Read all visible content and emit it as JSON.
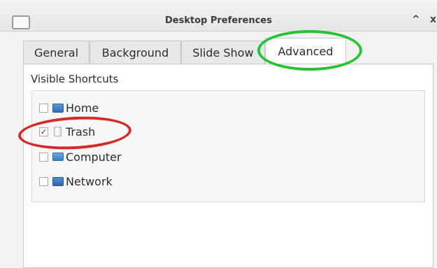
{
  "window": {
    "title": "Desktop Preferences",
    "maximize_glyph": "^",
    "close_glyph": "x"
  },
  "tabs": [
    {
      "label": "General",
      "active": false
    },
    {
      "label": "Background",
      "active": false
    },
    {
      "label": "Slide Show",
      "active": false
    },
    {
      "label": "Advanced",
      "active": true
    }
  ],
  "advanced": {
    "section_title": "Visible Shortcuts",
    "shortcuts": [
      {
        "label": "Home",
        "checked": false,
        "icon": "home-folder-icon"
      },
      {
        "label": "Trash",
        "checked": true,
        "icon": "trash-icon"
      },
      {
        "label": "Computer",
        "checked": false,
        "icon": "computer-icon"
      },
      {
        "label": "Network",
        "checked": false,
        "icon": "network-folder-icon"
      }
    ],
    "check_mark": "✓"
  },
  "annotations": {
    "green_circle_color": "#29c234",
    "red_circle_color": "#d42a2a"
  }
}
